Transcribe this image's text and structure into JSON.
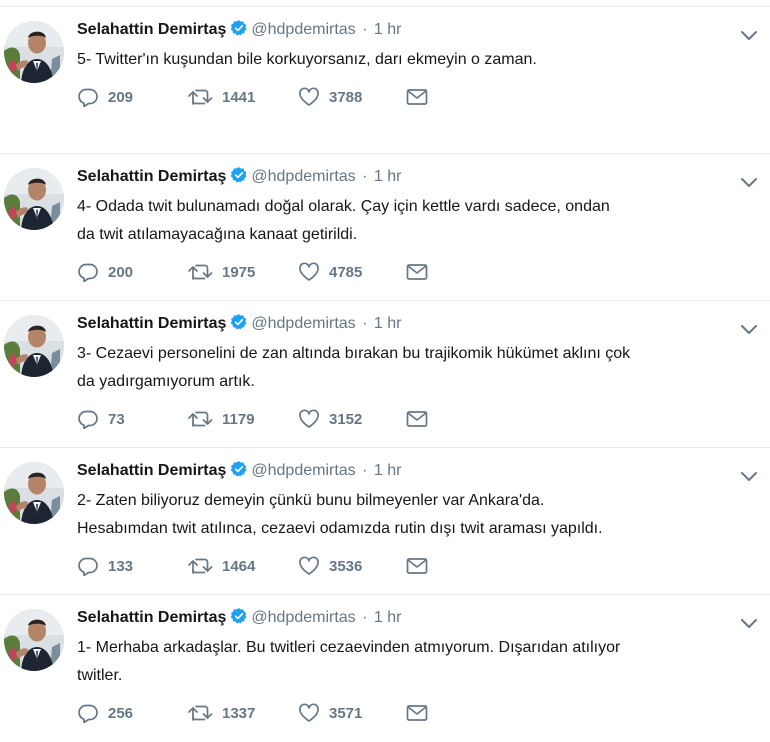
{
  "colors": {
    "text": "#14171a",
    "secondary": "#657786",
    "verified": "#1da1f2",
    "divider": "#e6ecf0"
  },
  "icons": {
    "reply": "reply-icon",
    "retweet": "retweet-icon",
    "like": "heart-icon",
    "dm": "envelope-icon",
    "verified": "verified-badge-icon",
    "more": "chevron-down-icon"
  },
  "tweets": [
    {
      "name": "Selahattin Demirtaş",
      "handle": "@hdpdemirtas",
      "dot": "·",
      "time": "1 hr",
      "lines": [
        "5- Twitter'ın kuşundan bile korkuyorsanız, darı ekmeyin o zaman."
      ],
      "replies": "209",
      "retweets": "1441",
      "likes": "3788"
    },
    {
      "name": "Selahattin Demirtaş",
      "handle": "@hdpdemirtas",
      "dot": "·",
      "time": "1 hr",
      "lines": [
        "4- Odada twit bulunamadı doğal olarak. Çay için kettle vardı sadece, ondan",
        "da twit atılamayacağına kanaat getirildi."
      ],
      "replies": "200",
      "retweets": "1975",
      "likes": "4785"
    },
    {
      "name": "Selahattin Demirtaş",
      "handle": "@hdpdemirtas",
      "dot": "·",
      "time": "1 hr",
      "lines": [
        "3- Cezaevi personelini de zan altında bırakan bu trajikomik hükümet aklını çok",
        "da yadırgamıyorum artık."
      ],
      "replies": "73",
      "retweets": "1179",
      "likes": "3152"
    },
    {
      "name": "Selahattin Demirtaş",
      "handle": "@hdpdemirtas",
      "dot": "·",
      "time": "1 hr",
      "lines": [
        "2- Zaten biliyoruz demeyin çünkü bunu bilmeyenler var Ankara'da.",
        "Hesabımdan twit atılınca, cezaevi odamızda rutin dışı twit araması yapıldı."
      ],
      "replies": "133",
      "retweets": "1464",
      "likes": "3536"
    },
    {
      "name": "Selahattin Demirtaş",
      "handle": "@hdpdemirtas",
      "dot": "·",
      "time": "1 hr",
      "lines": [
        "1- Merhaba arkadaşlar. Bu twitleri cezaevinden atmıyorum. Dışarıdan atılıyor",
        "twitler."
      ],
      "replies": "256",
      "retweets": "1337",
      "likes": "3571"
    }
  ]
}
